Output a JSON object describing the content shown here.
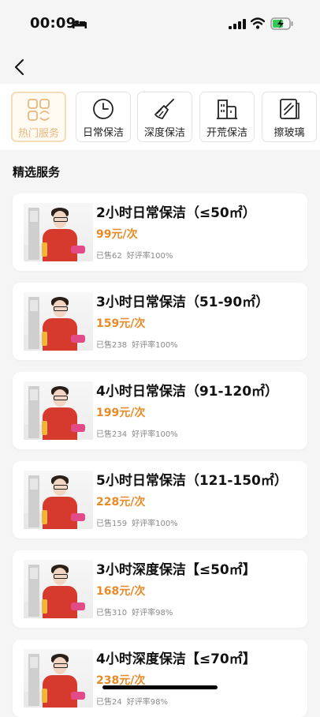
{
  "status_bar": {
    "time": "00:09",
    "icons": [
      "bed-icon",
      "signal-icon",
      "wifi-icon",
      "battery-icon"
    ]
  },
  "nav": {
    "back_icon": "chevron-left-icon"
  },
  "categories": [
    {
      "label": "热门服务",
      "icon": "grid-icon",
      "active": true
    },
    {
      "label": "日常保洁",
      "icon": "clock-icon",
      "active": false
    },
    {
      "label": "深度保洁",
      "icon": "broom-icon",
      "active": false
    },
    {
      "label": "开荒保洁",
      "icon": "building-icon",
      "active": false
    },
    {
      "label": "擦玻璃",
      "icon": "window-icon",
      "active": false
    }
  ],
  "section_title": "精选服务",
  "services": [
    {
      "title": "2小时日常保洁（≤50㎡）",
      "price": "99元/次",
      "sold": "已售62",
      "rating": "好评率100%"
    },
    {
      "title": "3小时日常保洁（51-90㎡）",
      "price": "159元/次",
      "sold": "已售238",
      "rating": "好评率100%"
    },
    {
      "title": "4小时日常保洁（91-120㎡）",
      "price": "199元/次",
      "sold": "已售234",
      "rating": "好评率100%"
    },
    {
      "title": "5小时日常保洁（121-150㎡）",
      "price": "228元/次",
      "sold": "已售159",
      "rating": "好评率100%"
    },
    {
      "title": "3小时深度保洁【≤50㎡】",
      "price": "168元/次",
      "sold": "已售310",
      "rating": "好评率98%"
    },
    {
      "title": "4小时深度保洁【≤70㎡】",
      "price": "238元/次",
      "sold": "已售24",
      "rating": "好评率98%"
    }
  ],
  "colors": {
    "accent_price": "#e98a28",
    "active_border": "#f6dcb4",
    "active_label": "#e8b77e"
  }
}
